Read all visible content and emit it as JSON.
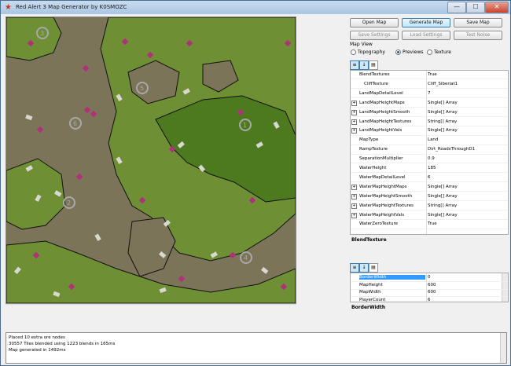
{
  "window": {
    "title": "Red Alert 3 Map Generator by K0SMOZC",
    "controls": [
      "—",
      "☐",
      "✕"
    ]
  },
  "toolbar": {
    "open_map": "Open Map",
    "generate_map": "Generate Map",
    "save_map": "Save Map",
    "save_settings": "Save Settings",
    "load_settings": "Load Settings",
    "test_noise": "Test Noise"
  },
  "map_view": {
    "group_label": "Map View",
    "options": [
      "Topography",
      "Previews",
      "Texture"
    ],
    "selected": "Previews"
  },
  "properties": [
    {
      "name": "BlendTextures",
      "value": "True",
      "expandable": false,
      "indent": false
    },
    {
      "name": "CliffTexture",
      "value": "Cliff_Siberiat1",
      "expandable": false,
      "indent": true
    },
    {
      "name": "LandMapDetailLevel",
      "value": "7",
      "expandable": false,
      "indent": false
    },
    {
      "name": "LandMapHeightMaps",
      "value": "Single[] Array",
      "expandable": true,
      "indent": false
    },
    {
      "name": "LandMapHeightSmooth",
      "value": "Single[] Array",
      "expandable": true,
      "indent": false
    },
    {
      "name": "LandMapHeightTextures",
      "value": "String[] Array",
      "expandable": true,
      "indent": false
    },
    {
      "name": "LandMapHeightVals",
      "value": "Single[] Array",
      "expandable": true,
      "indent": false
    },
    {
      "name": "MapType",
      "value": "Land",
      "expandable": false,
      "indent": false
    },
    {
      "name": "RampTexture",
      "value": "Dirt_RoadsThroughD1",
      "expandable": false,
      "indent": false
    },
    {
      "name": "SeparationMultiplier",
      "value": "0.9",
      "expandable": false,
      "indent": false
    },
    {
      "name": "WaterHeight",
      "value": "185",
      "expandable": false,
      "indent": false
    },
    {
      "name": "WaterMapDetailLevel",
      "value": "6",
      "expandable": false,
      "indent": false
    },
    {
      "name": "WaterMapHeightMaps",
      "value": "Single[] Array",
      "expandable": true,
      "indent": false
    },
    {
      "name": "WaterMapHeightSmooth",
      "value": "Single[] Array",
      "expandable": true,
      "indent": false
    },
    {
      "name": "WaterMapHeightTextures",
      "value": "String[] Array",
      "expandable": true,
      "indent": false
    },
    {
      "name": "WaterMapHeightVals",
      "value": "Single[] Array",
      "expandable": true,
      "indent": false
    },
    {
      "name": "WaterZeroTexture",
      "value": "True",
      "expandable": false,
      "indent": false
    }
  ],
  "property_description": {
    "title": "BlendTexture"
  },
  "properties2": [
    {
      "name": "BorderWidth",
      "value": "0",
      "selected": true
    },
    {
      "name": "MapHeight",
      "value": "600"
    },
    {
      "name": "MapWidth",
      "value": "600"
    },
    {
      "name": "PlayerCount",
      "value": "6"
    }
  ],
  "property_description2": {
    "title": "BorderWidth"
  },
  "log": [
    "Placed 10 extra ore nodes",
    "30557 Tiles blended using 1223 blends in 165ms",
    "Map generated in 1492ms"
  ],
  "player_starts": [
    "1",
    "2",
    "3",
    "4",
    "5",
    "6"
  ],
  "colors": {
    "lowland": "#7c7458",
    "highland": "#6e8f34",
    "peak": "#4e7a1f",
    "ore": "#b0307c",
    "ramp": "#d8d8d0",
    "start": "#a8a8a8"
  },
  "icons": {
    "app": "red-star-icon",
    "categorized": "categorized-icon",
    "alphabetical": "alphabetical-icon",
    "pages": "property-pages-icon"
  }
}
